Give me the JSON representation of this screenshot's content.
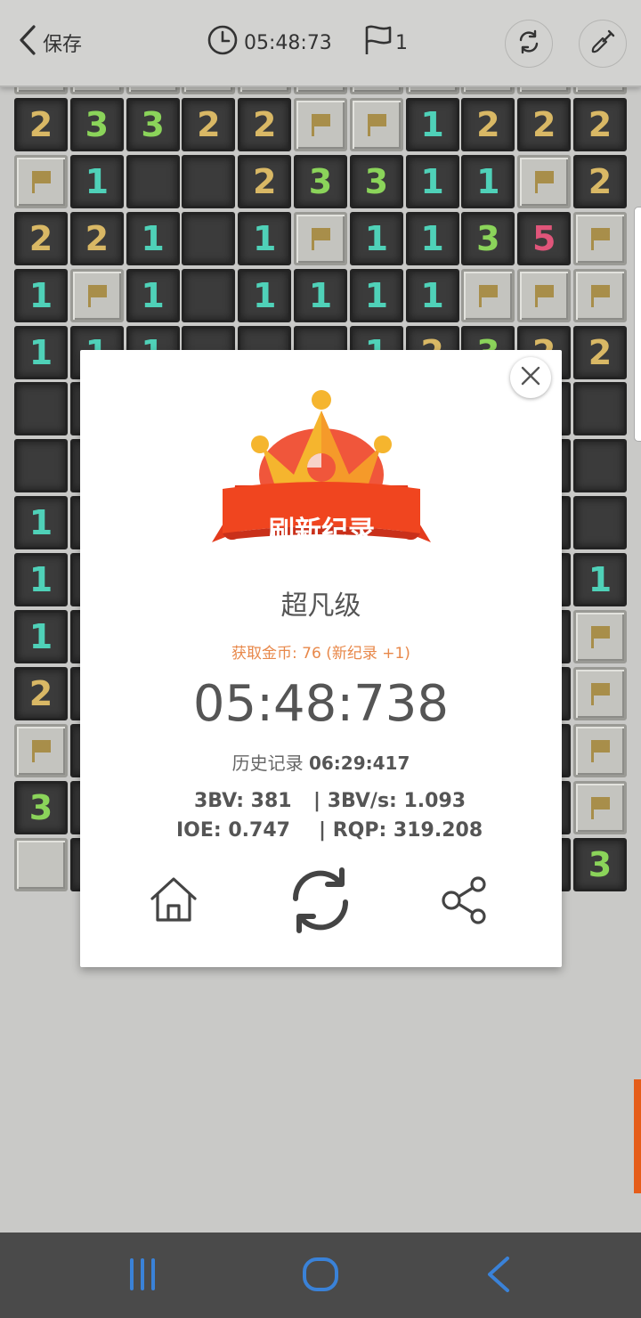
{
  "topbar": {
    "back_label": "保存",
    "timer": "05:48:73",
    "flag_count": "1"
  },
  "board": {
    "rows": [
      [
        "?",
        "?",
        "?",
        "?",
        "?",
        "?",
        "?",
        "?",
        "?",
        "?",
        "?"
      ],
      [
        "2",
        "3",
        "3",
        "2",
        "2",
        "F",
        "F",
        "1",
        "2",
        "2",
        "2"
      ],
      [
        "F",
        "1",
        "",
        "",
        "2",
        "3",
        "3",
        "1",
        "1",
        "F",
        "2"
      ],
      [
        "2",
        "2",
        "1",
        "",
        "1",
        "F",
        "1",
        "1",
        "3",
        "5",
        "F"
      ],
      [
        "1",
        "F",
        "1",
        "",
        "1",
        "1",
        "1",
        "1",
        "F",
        "F",
        "F"
      ],
      [
        "1",
        "1",
        "1",
        "",
        "",
        "",
        "1",
        "2",
        "3",
        "2",
        "2"
      ],
      [
        "",
        "",
        "",
        "",
        "",
        "",
        "",
        "",
        "",
        "",
        ""
      ],
      [
        "",
        "",
        "",
        "",
        "",
        "",
        "",
        "",
        "",
        "",
        ""
      ],
      [
        "1",
        "",
        "",
        "",
        "",
        "",
        "",
        "",
        "",
        "",
        ""
      ],
      [
        "1",
        "",
        "",
        "",
        "",
        "",
        "",
        "",
        "",
        "",
        "1"
      ],
      [
        "1",
        "",
        "",
        "",
        "",
        "",
        "",
        "",
        "",
        "",
        "F"
      ],
      [
        "2",
        "",
        "",
        "",
        "",
        "",
        "",
        "",
        "",
        "",
        "F"
      ],
      [
        "F",
        "",
        "",
        "",
        "",
        "",
        "",
        "",
        "",
        "",
        "F"
      ],
      [
        "3",
        "",
        "",
        "",
        "",
        "",
        "",
        "",
        "",
        "",
        "F"
      ],
      [
        "C",
        "",
        "",
        "",
        "",
        "",
        "",
        "",
        "",
        "",
        "3"
      ]
    ],
    "colors": {
      "1": "#4fd1b8",
      "2": "#d9b865",
      "3": "#8bd45a",
      "5": "#e0557a",
      "flag": "#a88e4a"
    }
  },
  "modal": {
    "banner": "刷新纪录",
    "level": "超凡级",
    "coins": "获取金币: 76 (新纪录 +1)",
    "time": "05:48:738",
    "history_label": "历史记录",
    "history_value": "06:29:417",
    "stat_3bv": "3BV: 381",
    "stat_3bvs": "| 3BV/s: 1.093",
    "stat_ioe": "IOE: 0.747",
    "stat_rqp": "| RQP: 319.208"
  },
  "icons": {
    "back": "chevron-left-icon",
    "clock": "clock-icon",
    "flag": "flag-icon",
    "refresh": "refresh-icon",
    "shovel": "shovel-icon",
    "close": "close-icon",
    "home": "home-icon",
    "restart": "restart-icon",
    "share": "share-icon",
    "nav_recents": "recent-apps-icon",
    "nav_home": "nav-home-icon",
    "nav_back": "nav-back-icon"
  }
}
